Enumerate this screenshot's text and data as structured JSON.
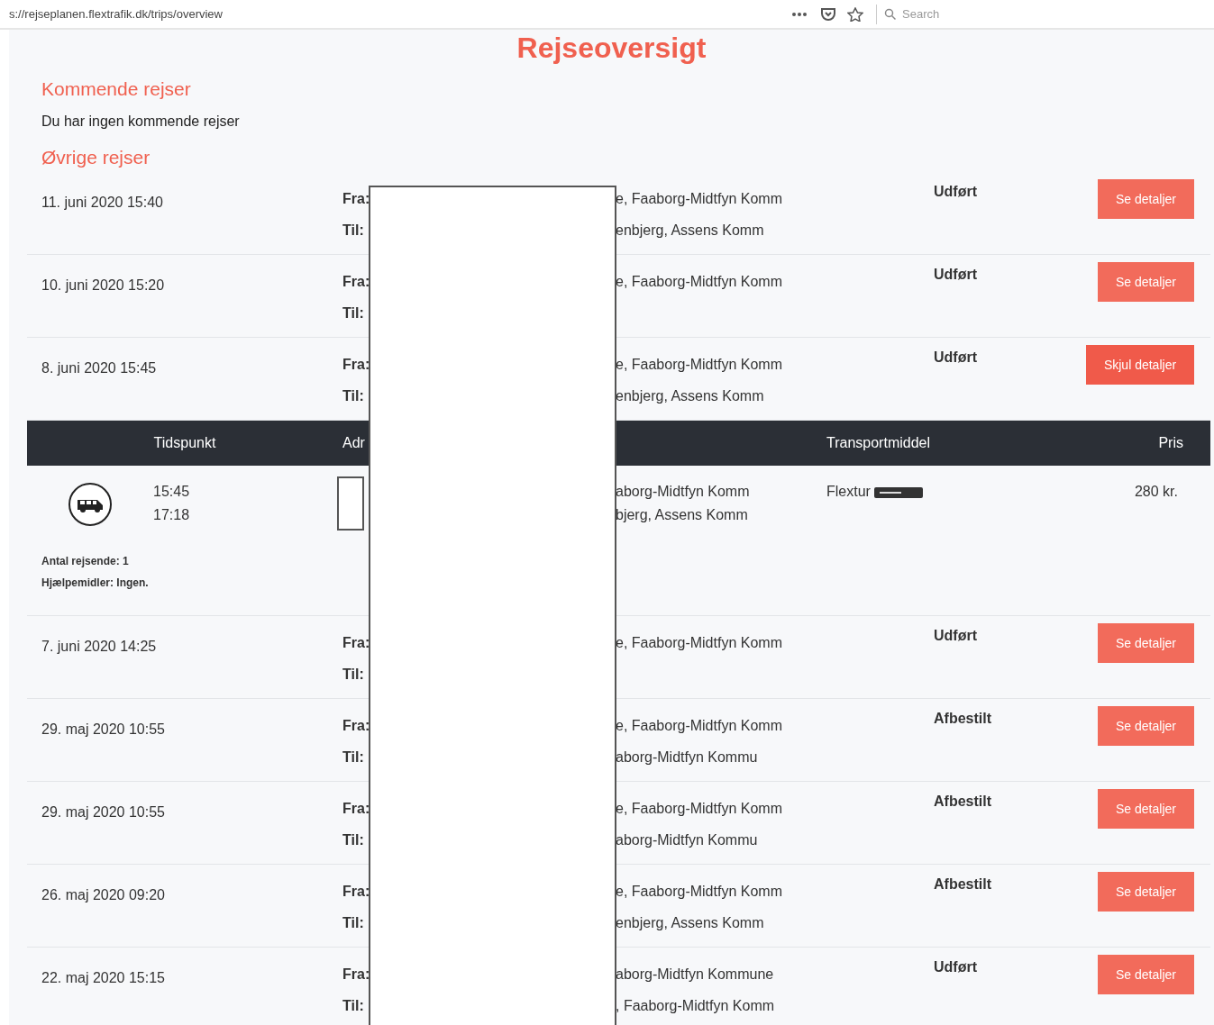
{
  "browser": {
    "url": "s://rejseplanen.flextrafik.dk/trips/overview",
    "search": {
      "placeholder": "Search"
    }
  },
  "title": "Rejseoversigt",
  "upcoming": {
    "heading": "Kommende rejser",
    "message": "Du har ingen kommende rejser"
  },
  "other": {
    "heading": "Øvrige rejser",
    "trips": [
      {
        "date": "11. juni 2020 15:40",
        "from_label": "Fra:",
        "from": "e, Faaborg-Midtfyn Komm",
        "to_label": "Til:",
        "to": "enbjerg, Assens Komm",
        "status": "Udført",
        "button": "Se detaljer",
        "expanded": false
      },
      {
        "date": "10. juni 2020 15:20",
        "from_label": "Fra:",
        "from": "e, Faaborg-Midtfyn Komm",
        "to_label": "Til:",
        "status": "Udført",
        "button": "Se detaljer",
        "expanded": false
      },
      {
        "date": "8. juni 2020 15:45",
        "from_label": "Fra:",
        "from": "e, Faaborg-Midtfyn Komm",
        "to_label": "Til:",
        "to": "enbjerg, Assens Komm",
        "status": "Udført",
        "button": "Skjul detaljer",
        "expanded": true
      },
      {
        "date": "7. juni 2020 14:25",
        "from_label": "Fra:",
        "from": "e, Faaborg-Midtfyn Komm",
        "to_label": "Til:",
        "status": "Udført",
        "button": "Se detaljer",
        "expanded": false
      },
      {
        "date": "29. maj 2020 10:55",
        "from_label": "Fra:",
        "from": "e, Faaborg-Midtfyn Komm",
        "to_label": "Til:",
        "to": "aborg-Midtfyn Kommu",
        "status": "Afbestilt",
        "button": "Se detaljer",
        "expanded": false
      },
      {
        "date": "29. maj 2020 10:55",
        "from_label": "Fra:",
        "from": "e, Faaborg-Midtfyn Komm",
        "to_label": "Til:",
        "to": "aborg-Midtfyn Kommu",
        "status": "Afbestilt",
        "button": "Se detaljer",
        "expanded": false
      },
      {
        "date": "26. maj 2020 09:20",
        "from_label": "Fra:",
        "from": "e, Faaborg-Midtfyn Komm",
        "to_label": "Til:",
        "to": "enbjerg, Assens Komm",
        "status": "Afbestilt",
        "button": "Se detaljer",
        "expanded": false
      },
      {
        "date": "22. maj 2020 15:15",
        "from_label": "Fra:",
        "from": "aborg-Midtfyn Kommune",
        "to_label": "Til:",
        "to": ", Faaborg-Midtfyn Komm",
        "status": "Udført",
        "button": "Se detaljer",
        "expanded": false
      }
    ]
  },
  "details": {
    "columns": [
      "Tidspunkt",
      "Adr",
      "Transportmiddel",
      "Pris"
    ],
    "departure": "15:45",
    "arrival": "17:18",
    "from": "aborg-Midtfyn Komm",
    "to": "bjerg, Assens Komm",
    "transport": "Flextur",
    "price": "280 kr.",
    "travellers": "Antal rejsende: 1",
    "aids": "Hjælpemidler: Ingen."
  }
}
